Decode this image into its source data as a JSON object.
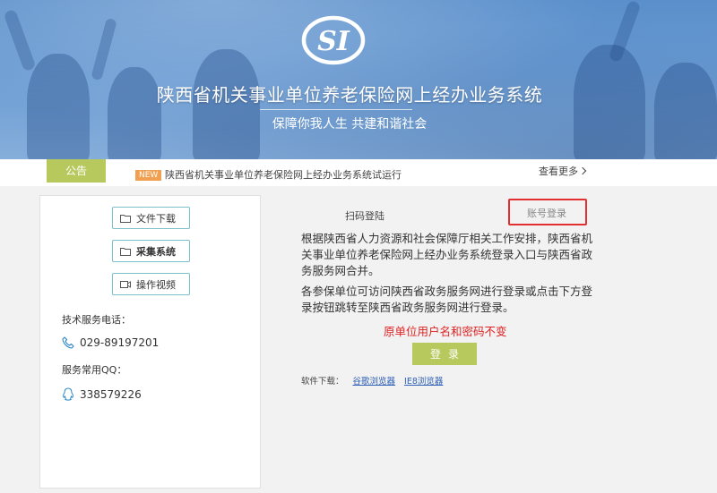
{
  "header": {
    "site_title": "陕西省机关事业单位养老保险网上经办业务系统",
    "slogan": "保障你我人生  共建和谐社会",
    "logo_icon": "si-logo-icon"
  },
  "notice": {
    "tab_label": "公告",
    "badge": "NEW",
    "text": "陕西省机关事业单位养老保险网上经办业务系统试运行",
    "more_label": "查看更多"
  },
  "sidebar": {
    "buttons": [
      {
        "label": "文件下载",
        "icon": "folder-icon"
      },
      {
        "label": "采集系统",
        "icon": "folder-icon"
      },
      {
        "label": "操作视频",
        "icon": "video-icon"
      }
    ],
    "phone_label": "技术服务电话：",
    "phone": "029-89197201",
    "qq_label": "服务常用QQ：",
    "qq": "338579226"
  },
  "login": {
    "tabs": [
      {
        "label": "扫码登陆"
      },
      {
        "label": "账号登录"
      }
    ],
    "desc1": "根据陕西省人力资源和社会保障厅相关工作安排，陕西省机关事业单位养老保险网上经办业务系统登录入口与陕西省政务服务网合并。",
    "desc2": "各参保单位可访问陕西省政务服务网进行登录或点击下方登录按钮跳转至陕西省政务服务网进行登录。",
    "warning": "原单位用户名和密码不变",
    "button": "登录",
    "download_label": "软件下载：",
    "download_links": [
      "谷歌浏览器",
      "IE8浏览器"
    ]
  },
  "colors": {
    "accent_green": "#b7c95d",
    "border_teal": "#7ac1c9",
    "warning_red": "#e02020",
    "highlight_red": "#e23030",
    "link_blue": "#2e5fb5"
  }
}
